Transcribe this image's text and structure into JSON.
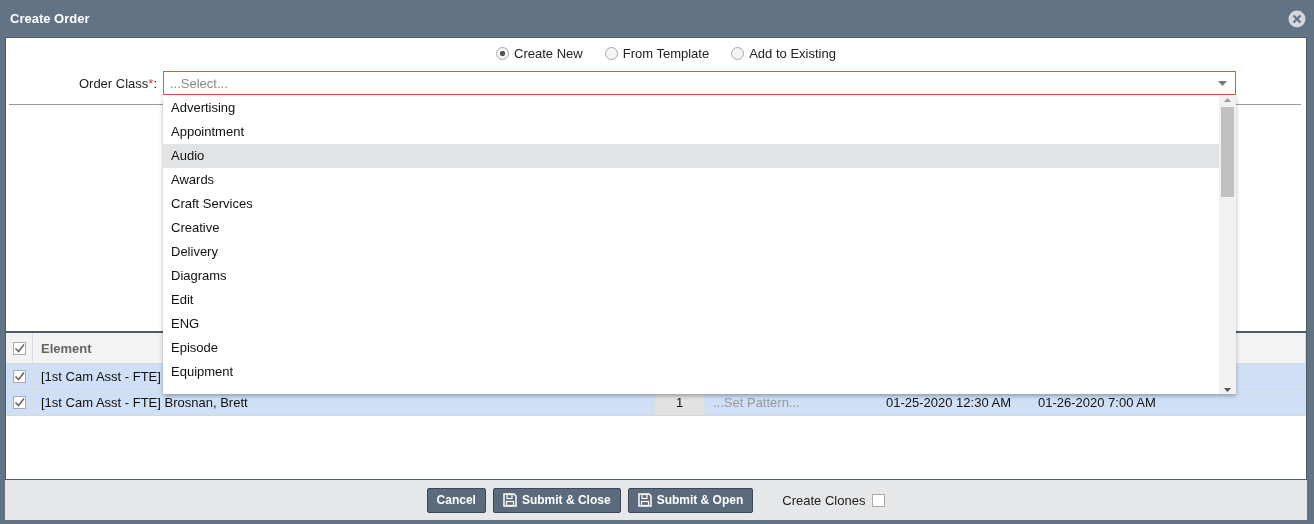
{
  "window": {
    "title": "Create Order"
  },
  "modes": [
    {
      "label": "Create New",
      "selected": true
    },
    {
      "label": "From Template",
      "selected": false
    },
    {
      "label": "Add to Existing",
      "selected": false
    }
  ],
  "order_class": {
    "label": "Order Class",
    "required_mark": "*",
    "suffix": ":",
    "placeholder": "...Select...",
    "options": [
      {
        "label": "Advertising",
        "highlighted": false
      },
      {
        "label": "Appointment",
        "highlighted": false
      },
      {
        "label": "Audio",
        "highlighted": true
      },
      {
        "label": "Awards",
        "highlighted": false
      },
      {
        "label": "Craft Services",
        "highlighted": false
      },
      {
        "label": "Creative",
        "highlighted": false
      },
      {
        "label": "Delivery",
        "highlighted": false
      },
      {
        "label": "Diagrams",
        "highlighted": false
      },
      {
        "label": "Edit",
        "highlighted": false
      },
      {
        "label": "ENG",
        "highlighted": false
      },
      {
        "label": "Episode",
        "highlighted": false
      },
      {
        "label": "Equipment",
        "highlighted": false
      }
    ]
  },
  "table": {
    "header": {
      "checked": true,
      "columns": [
        "Element"
      ]
    },
    "rows": [
      {
        "checked": true,
        "cells": [
          "[1st Cam Asst - FTE]"
        ]
      },
      {
        "checked": true,
        "cells": [
          "[1st Cam Asst - FTE] Brosnan, Brett",
          "1",
          "...Set Pattern...",
          "01-25-2020 12:30 AM",
          "01-26-2020 7:00 AM"
        ]
      }
    ]
  },
  "footer": {
    "buttons": [
      {
        "label": "Cancel",
        "kind": "plain"
      },
      {
        "label": "Submit & Close",
        "kind": "save"
      },
      {
        "label": "Submit & Open",
        "kind": "save"
      }
    ],
    "create_clones": {
      "label": "Create Clones",
      "checked": false
    }
  }
}
